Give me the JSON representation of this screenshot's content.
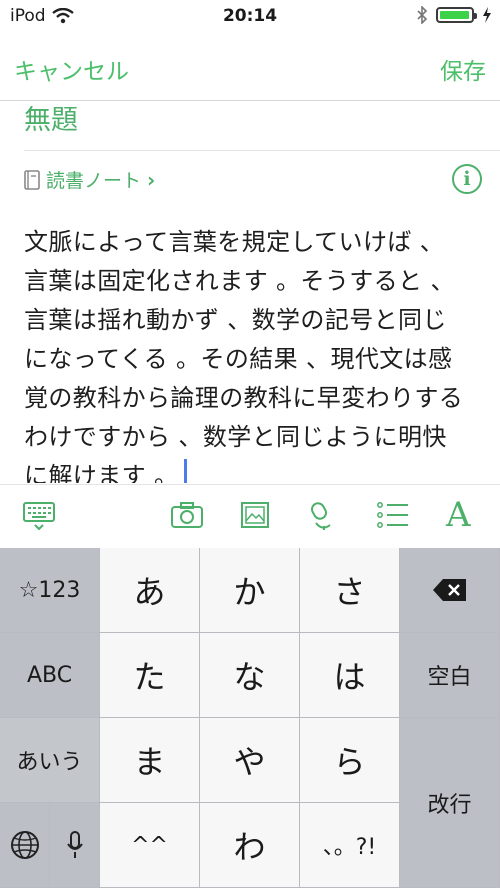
{
  "status_bar": {
    "carrier": "iPod",
    "time": "20:14",
    "battery_level": 0.95
  },
  "nav": {
    "cancel": "キャンセル",
    "save": "保存"
  },
  "note": {
    "title": "無題",
    "notebook": "読書ノート",
    "body_lines": [
      "文脈によって言葉を規定していけば 、",
      "言葉は固定化されます 。そうすると 、",
      "言葉は揺れ動かず 、数学の記号と同じ",
      "になってくる 。その結果 、現代文は感",
      "覚の教科から論理の教科に早変わりする",
      "わけですから 、数学と同じように明快",
      "に解けます 。"
    ]
  },
  "toolbar": {
    "icons": [
      "keyboard-hide-icon",
      "camera-icon",
      "image-icon",
      "microphone-icon",
      "list-icon",
      "text-format-icon"
    ],
    "format_label": "A"
  },
  "keyboard": {
    "keys": {
      "sym": "☆123",
      "abc": "ABC",
      "aiu": "あいう",
      "a": "あ",
      "ka": "か",
      "sa": "さ",
      "ta": "た",
      "na": "な",
      "ha": "は",
      "ma": "ま",
      "ya": "や",
      "ra": "ら",
      "kao": "^^",
      "wa": "わ",
      "punct": "、。?!",
      "space": "空白",
      "newline": "改行"
    }
  },
  "colors": {
    "accent": "#4caf6a",
    "cursor": "#4d7be8",
    "battery": "#3bd24a"
  }
}
